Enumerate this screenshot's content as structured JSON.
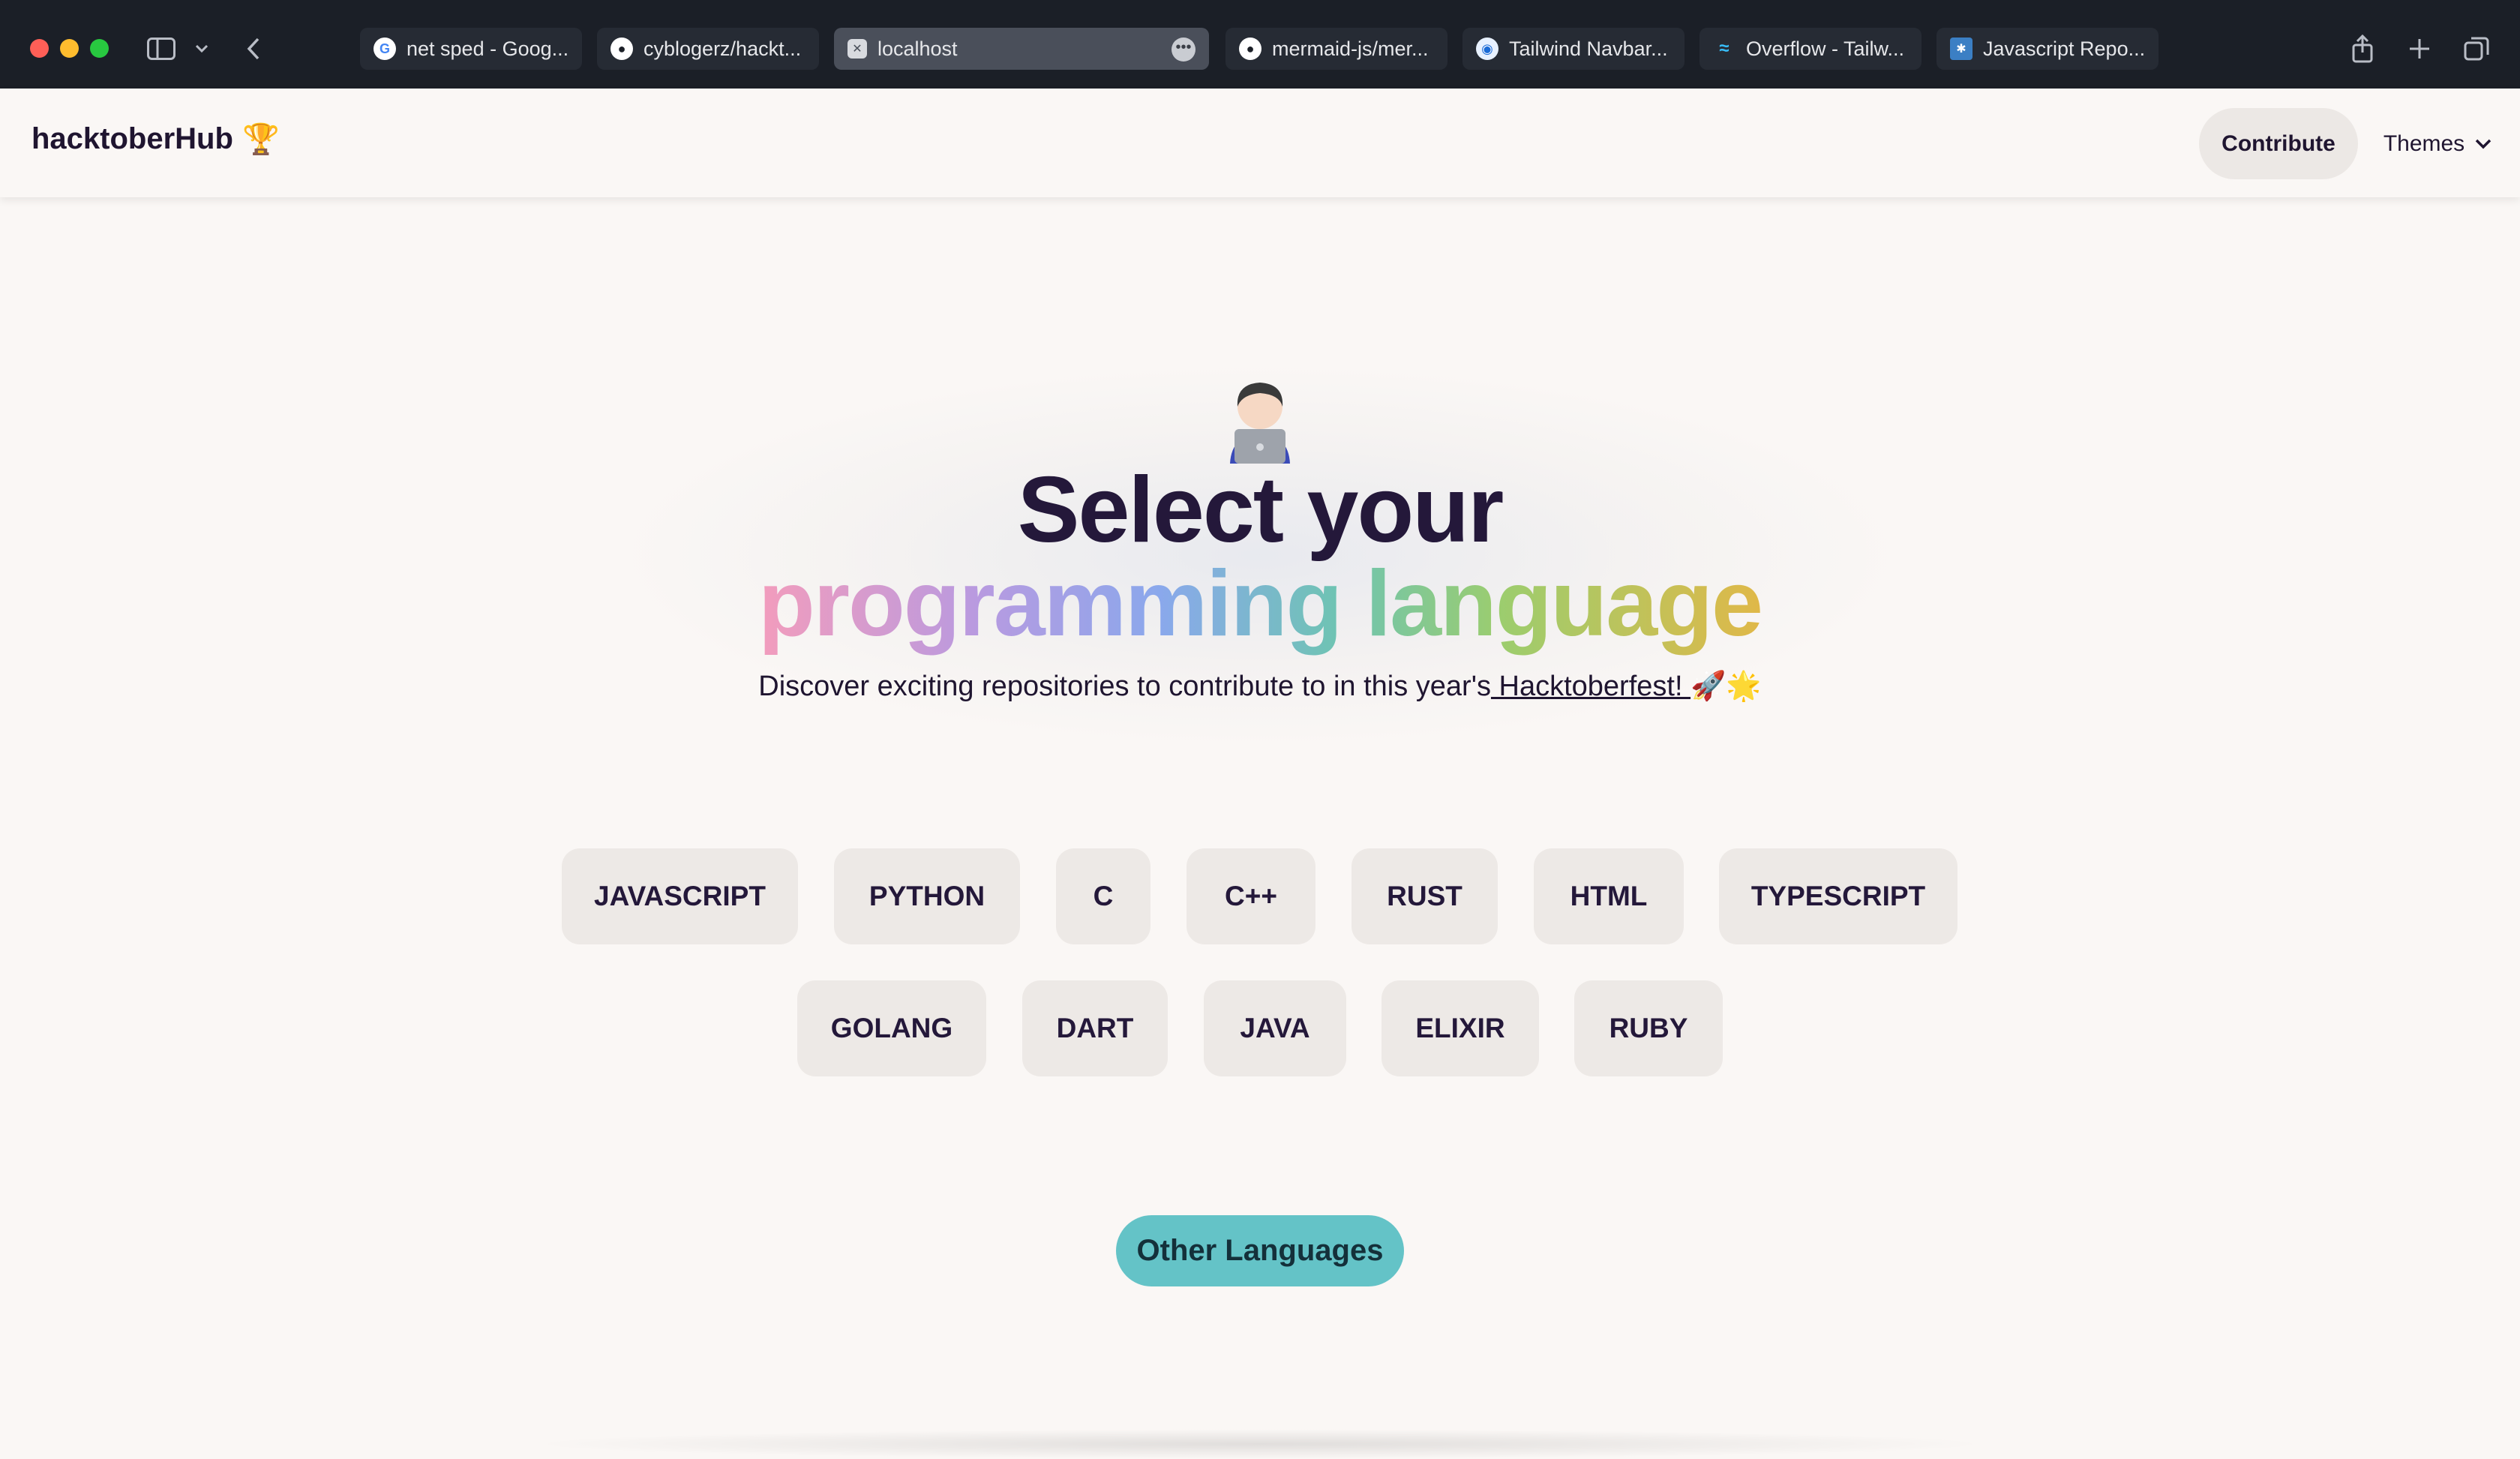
{
  "browser": {
    "tabs": [
      {
        "label": "net sped - Goog...",
        "icon": "google-icon"
      },
      {
        "label": "cyblogerz/hackt...",
        "icon": "github-icon"
      },
      {
        "label": "localhost",
        "icon": "close-icon",
        "active": true
      },
      {
        "label": "mermaid-js/mer...",
        "icon": "github-icon"
      },
      {
        "label": "Tailwind Navbar...",
        "icon": "tailwind-navbar-icon"
      },
      {
        "label": "Overflow - Tailw...",
        "icon": "tailwind-icon"
      },
      {
        "label": "Javascript Repo...",
        "icon": "repo-icon"
      }
    ]
  },
  "navbar": {
    "brand": "hacktoberHub",
    "brand_emoji": "🏆",
    "contribute_label": "Contribute",
    "themes_label": "Themes"
  },
  "hero": {
    "emoji": "🧑🏻‍💻",
    "line1": "Select your",
    "line2": "programming language",
    "subtitle_prefix": "Discover exciting repositories to contribute to in this year's",
    "subtitle_link": " Hacktoberfest! ",
    "subtitle_emojis": "🚀🌟"
  },
  "languages": {
    "row1": [
      "JAVASCRIPT",
      "PYTHON",
      "C",
      "C++",
      "RUST",
      "HTML",
      "TYPESCRIPT"
    ],
    "row2": [
      "GOLANG",
      "DART",
      "JAVA",
      "ELIXIR",
      "RUBY"
    ]
  },
  "other_languages_label": "Other Languages",
  "colors": {
    "accent": "#64c3c7",
    "background": "#faf7f5",
    "chip": "#ede9e6",
    "text": "#24183a"
  }
}
